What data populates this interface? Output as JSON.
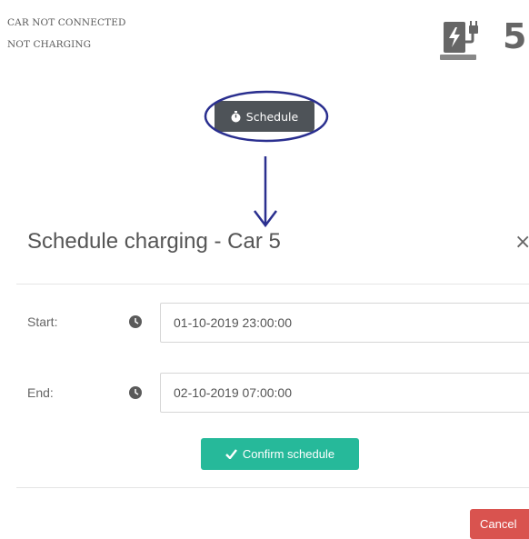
{
  "status": {
    "connection": "CAR NOT CONNECTED",
    "charging": "NOT CHARGING"
  },
  "charger": {
    "icon": "ev-charger-icon",
    "car_number": "5"
  },
  "schedule_button": {
    "icon": "stopwatch-icon",
    "label": "Schedule"
  },
  "modal": {
    "title": "Schedule charging - Car 5",
    "close_label": "×",
    "start": {
      "label": "Start:",
      "icon": "clock-icon",
      "value": "01-10-2019 23:00:00"
    },
    "end": {
      "label": "End:",
      "icon": "clock-icon",
      "value": "02-10-2019 07:00:00"
    },
    "confirm_button": {
      "icon": "check-icon",
      "label": "Confirm schedule"
    },
    "cancel_button": {
      "label": "Cancel"
    }
  },
  "colors": {
    "schedule_button_bg": "#4e5358",
    "annotation_blue": "#2a2f8f",
    "confirm_green": "#26b99a",
    "cancel_red": "#d9534f"
  }
}
